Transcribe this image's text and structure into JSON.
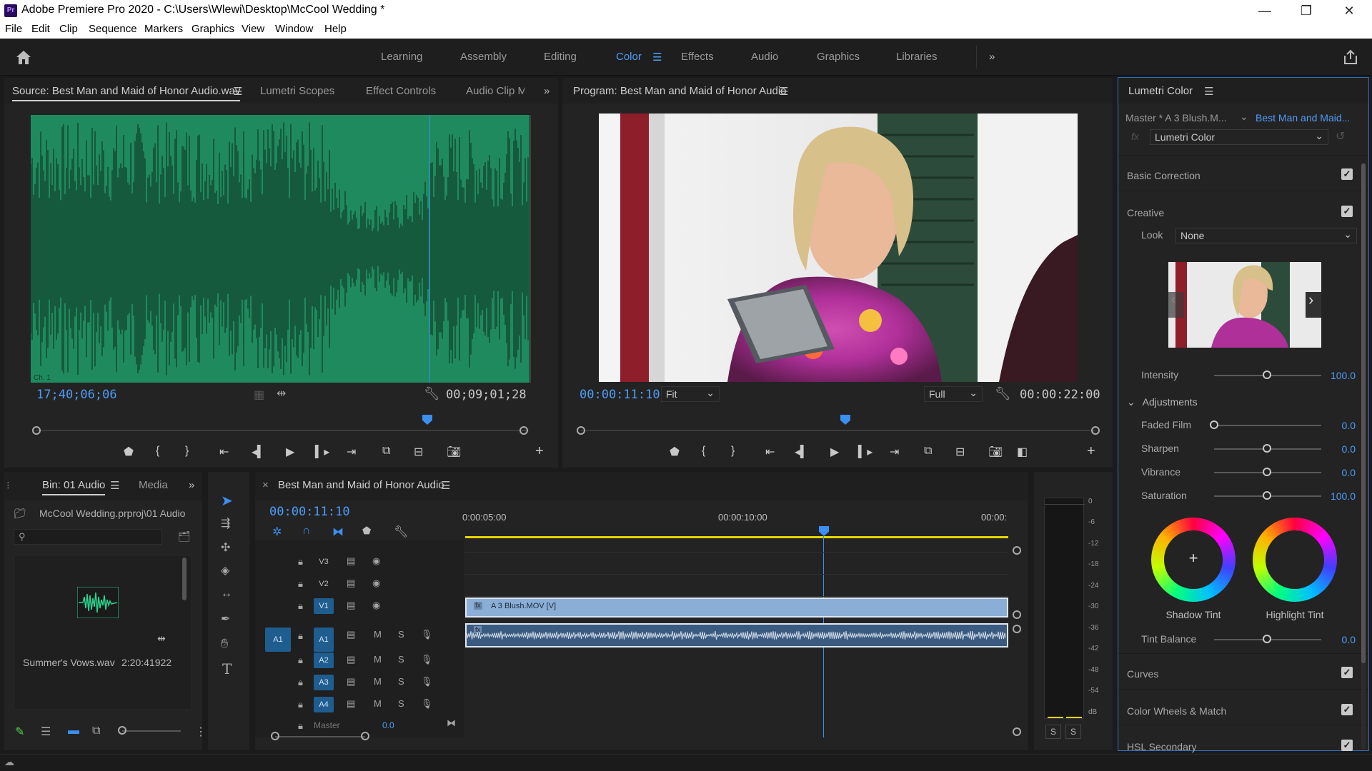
{
  "window": {
    "title": "Adobe Premiere Pro 2020 - C:\\Users\\Wlewi\\Desktop\\McCool Wedding *",
    "app_icon_text": "Pr"
  },
  "menu": [
    "File",
    "Edit",
    "Clip",
    "Sequence",
    "Markers",
    "Graphics",
    "View",
    "Window",
    "Help"
  ],
  "workspaces": {
    "tabs": [
      "Learning",
      "Assembly",
      "Editing",
      "Color",
      "Effects",
      "Audio",
      "Graphics",
      "Libraries"
    ],
    "active": "Color"
  },
  "source_panel": {
    "tabs": [
      "Source: Best Man and Maid of Honor Audio.wav",
      "Lumetri Scopes",
      "Effect Controls",
      "Audio Clip M"
    ],
    "channel_label": "Ch. 1",
    "timecode_in": "17;40;06;06",
    "duration": "00;09;01;28",
    "playhead_fraction": 0.8
  },
  "program_panel": {
    "title": "Program: Best Man and Maid of Honor Audio",
    "timecode": "00:00:11:10",
    "fit": "Fit",
    "quality": "Full",
    "duration": "00:00:22:00",
    "playhead_fraction": 0.51
  },
  "bin_panel": {
    "tabs": [
      "Bin: 01 Audio",
      "Media"
    ],
    "path": "McCool Wedding.prproj\\01 Audio",
    "search_placeholder": "",
    "item_name": "Summer's Vows.wav",
    "item_duration": "2:20:41922"
  },
  "timeline": {
    "title": "Best Man and Maid of Honor Audio",
    "timecode": "00:00:11:10",
    "ruler": [
      "0:00:05:00",
      "00:00:10:00",
      "00:00:"
    ],
    "video_tracks": [
      "V3",
      "V2",
      "V1"
    ],
    "audio_tracks": [
      "A1",
      "A2",
      "A3",
      "A4"
    ],
    "source_patch": "A1",
    "master_label": "Master",
    "master_value": "0.0",
    "video_clip": "A 3 Blush.MOV [V]",
    "fx_badge": "fx",
    "mute_label": "M",
    "solo_label": "S"
  },
  "meter": {
    "scale": [
      "0",
      "-6",
      "-12",
      "-18",
      "-24",
      "-30",
      "-36",
      "-42",
      "-48",
      "-54",
      "dB"
    ],
    "solo_buttons": [
      "S",
      "S"
    ]
  },
  "lumetri": {
    "title": "Lumetri Color",
    "master_clip": "Master * A 3 Blush.M...",
    "sequence_clip": "Best Man and Maid...",
    "effect": "Lumetri Color",
    "fx_label": "fx",
    "sections": {
      "basic": "Basic Correction",
      "creative": "Creative",
      "curves": "Curves",
      "wheels": "Color Wheels & Match",
      "hsl": "HSL Secondary"
    },
    "look_label": "Look",
    "look_value": "None",
    "intensity_label": "Intensity",
    "intensity": "100.0",
    "adjustments_label": "Adjustments",
    "faded_film_label": "Faded Film",
    "faded_film": "0.0",
    "sharpen_label": "Sharpen",
    "sharpen": "0.0",
    "vibrance_label": "Vibrance",
    "vibrance": "0.0",
    "saturation_label": "Saturation",
    "saturation": "100.0",
    "shadow_tint_label": "Shadow Tint",
    "highlight_tint_label": "Highlight Tint",
    "tint_balance_label": "Tint Balance",
    "tint_balance": "0.0"
  },
  "colors": {
    "accent": "#4f9cf7",
    "waveform_bg": "#1f8a5e",
    "video_clip": "#8aaed6",
    "audio_clip": "#3a5a80"
  }
}
